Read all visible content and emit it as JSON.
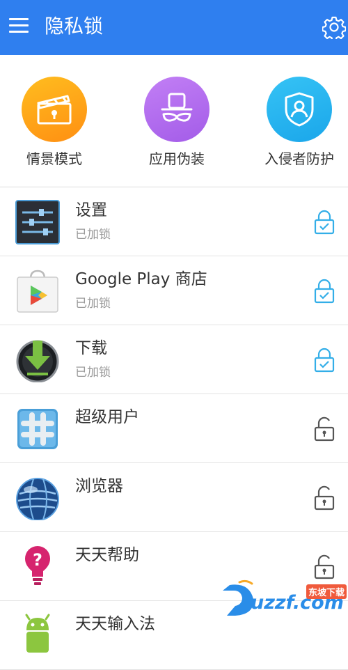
{
  "appbar": {
    "title": "隐私锁",
    "menu_icon": "menu-icon",
    "settings_icon": "gear-icon",
    "color": "#2f7fef"
  },
  "features": [
    {
      "label": "情景模式",
      "icon": "clapperboard-lock-icon",
      "color": "#ffa21a"
    },
    {
      "label": "应用伪装",
      "icon": "disguise-hat-icon",
      "color": "#b56ff0"
    },
    {
      "label": "入侵者防护",
      "icon": "shield-user-icon",
      "color": "#24b3f0"
    }
  ],
  "apps": [
    {
      "name": "设置",
      "status": "已加锁",
      "icon": "settings-app-icon",
      "locked": true
    },
    {
      "name": "Google Play 商店",
      "status": "已加锁",
      "icon": "play-store-icon",
      "locked": true
    },
    {
      "name": "下载",
      "status": "已加锁",
      "icon": "download-app-icon",
      "locked": true
    },
    {
      "name": "超级用户",
      "status": "",
      "icon": "superuser-app-icon",
      "locked": false
    },
    {
      "name": "浏览器",
      "status": "",
      "icon": "browser-app-icon",
      "locked": false
    },
    {
      "name": "天天帮助",
      "status": "",
      "icon": "help-app-icon",
      "locked": false
    },
    {
      "name": "天天输入法",
      "status": "",
      "icon": "input-method-app-icon",
      "locked": false
    }
  ],
  "colors": {
    "lock_active": "#33aee8",
    "lock_inactive": "#555555",
    "status_text": "#999999"
  },
  "watermark": {
    "text": "uzzf.com",
    "tag": "东坡下载"
  }
}
